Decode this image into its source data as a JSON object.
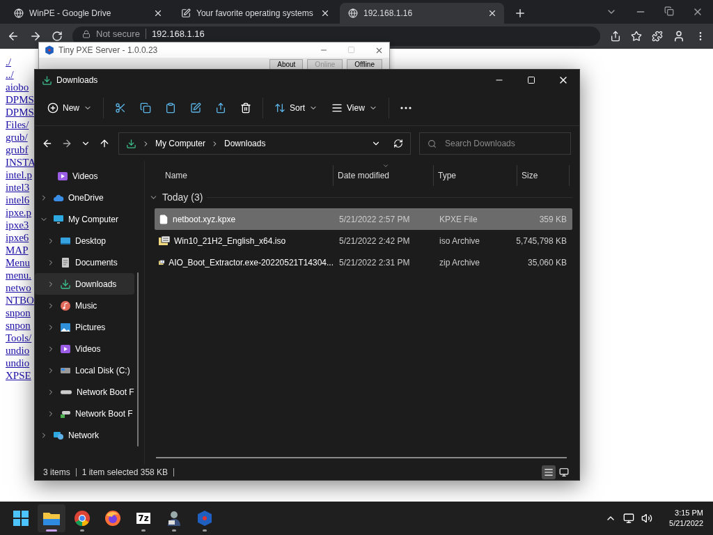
{
  "browser": {
    "tabs": [
      {
        "title": "WinPE - Google Drive",
        "selected": false
      },
      {
        "title": "Your favorite operating systems",
        "selected": false
      },
      {
        "title": "192.168.1.16",
        "selected": true
      }
    ],
    "security": "Not secure",
    "url": "192.168.1.16"
  },
  "page": {
    "links": [
      "./",
      "../",
      "aiobo",
      "DPMS",
      "DPMS",
      "Files/",
      "grub/",
      "grubf",
      "INSTA",
      "intel.p",
      "intel3",
      "intel6",
      "ipxe.p",
      "ipxe3",
      "ipxe6",
      "MAP",
      "Menu",
      "menu.",
      "netwo",
      "NTBO",
      "snpon",
      "snpon",
      "Tools/",
      "undio",
      "undio",
      "XPSE"
    ]
  },
  "pxe_window": {
    "title": "Tiny PXE Server - 1.0.0.23",
    "buttons": [
      {
        "label": "About",
        "disabled": false
      },
      {
        "label": "Online",
        "disabled": true
      },
      {
        "label": "Offline",
        "disabled": false
      }
    ]
  },
  "explorer": {
    "title": "Downloads",
    "toolbar": {
      "new": "New",
      "sort": "Sort",
      "view": "View"
    },
    "breadcrumb": [
      "My Computer",
      "Downloads"
    ],
    "search": {
      "placeholder": "Search Downloads"
    },
    "sidebar": {
      "items": [
        {
          "label": "Videos",
          "kind": "videos"
        },
        {
          "label": "OneDrive",
          "kind": "cloud",
          "expanded": false
        },
        {
          "label": "My Computer",
          "kind": "computer",
          "expanded": true,
          "children": [
            {
              "label": "Desktop",
              "kind": "desktop",
              "expanded": false,
              "selected": false
            },
            {
              "label": "Documents",
              "kind": "documents",
              "expanded": false,
              "selected": false
            },
            {
              "label": "Downloads",
              "kind": "downloads",
              "expanded": false,
              "selected": true
            },
            {
              "label": "Music",
              "kind": "music",
              "expanded": false,
              "selected": false
            },
            {
              "label": "Pictures",
              "kind": "pictures",
              "expanded": false,
              "selected": false
            },
            {
              "label": "Videos",
              "kind": "videos",
              "expanded": false,
              "selected": false
            },
            {
              "label": "Local Disk (C:)",
              "kind": "disk",
              "expanded": false,
              "selected": false
            },
            {
              "label": "Network Boot F",
              "kind": "drive",
              "expanded": false,
              "selected": false
            },
            {
              "label": "Network Boot F",
              "kind": "netdrive",
              "expanded": false,
              "selected": false
            }
          ]
        },
        {
          "label": "Network",
          "kind": "network",
          "expanded": false
        }
      ]
    },
    "columns": [
      "Name",
      "Date modified",
      "Type",
      "Size"
    ],
    "group": {
      "label": "Today (3)",
      "expanded": true,
      "files": [
        {
          "name": "netboot.xyz.kpxe",
          "date": "5/21/2022 2:57 PM",
          "type": "KPXE File",
          "size": "359 KB",
          "kind": "file",
          "selected": true
        },
        {
          "name": "Win10_21H2_English_x64.iso",
          "date": "5/21/2022 2:42 PM",
          "type": "iso Archive",
          "size": "5,745,798 KB",
          "kind": "iso",
          "selected": false
        },
        {
          "name": "AIO_Boot_Extractor.exe-20220521T14304...",
          "date": "5/21/2022 2:31 PM",
          "type": "zip Archive",
          "size": "35,060 KB",
          "kind": "zip",
          "selected": false
        }
      ]
    },
    "status": {
      "count": "3 items",
      "selection": "1 item selected",
      "size": "358 KB"
    },
    "view_modes": [
      {
        "kind": "details",
        "selected": true
      },
      {
        "kind": "tiles",
        "selected": false
      }
    ]
  },
  "taskbar": {
    "apps": [
      {
        "kind": "explorer",
        "selected": true,
        "running": true
      },
      {
        "kind": "chrome",
        "selected": false,
        "running": true
      },
      {
        "kind": "firefox",
        "selected": false,
        "running": false
      },
      {
        "kind": "archiver",
        "selected": false,
        "running": true,
        "label": "7z"
      },
      {
        "kind": "agent",
        "selected": false,
        "running": true
      },
      {
        "kind": "cube",
        "selected": false,
        "running": true
      }
    ],
    "clock": {
      "time": "3:15 PM",
      "date": "5/21/2022"
    }
  }
}
